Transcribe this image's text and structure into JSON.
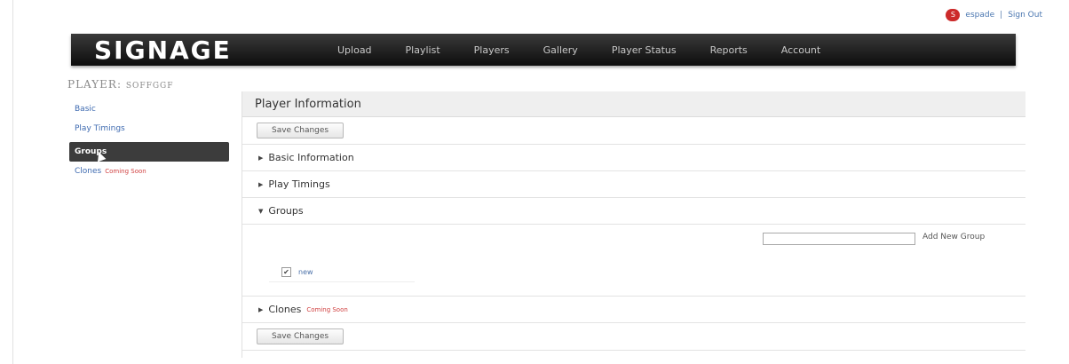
{
  "userbar": {
    "username": "espade",
    "separator": "|",
    "signout": "Sign Out"
  },
  "header": {
    "logo": "SIGNAGE"
  },
  "nav": [
    "Upload",
    "Playlist",
    "Players",
    "Gallery",
    "Player Status",
    "Reports",
    "Account"
  ],
  "page": {
    "title_prefix": "PLAYER:",
    "title_name": "SOFFGGF"
  },
  "subnav": {
    "basic": "Basic",
    "play_timings": "Play Timings",
    "groups": "Groups",
    "clones": "Clones",
    "clones_soon": "Coming Soon"
  },
  "panel": {
    "title": "Player Information",
    "save_top": "Save Changes",
    "save_bottom": "Save Changes",
    "sections": {
      "basic": "Basic Information",
      "play_timings": "Play Timings",
      "groups": "Groups",
      "clones": "Clones",
      "clones_soon": "Coming Soon"
    },
    "group_input_value": "",
    "add_group_label": "Add New Group",
    "groups": [
      {
        "name": "new",
        "checked": true
      }
    ]
  },
  "colors": {
    "header_bg": "#111111",
    "link": "#3e6ab0",
    "active_nav": "#3c3c3c",
    "soon": "#d04040"
  }
}
